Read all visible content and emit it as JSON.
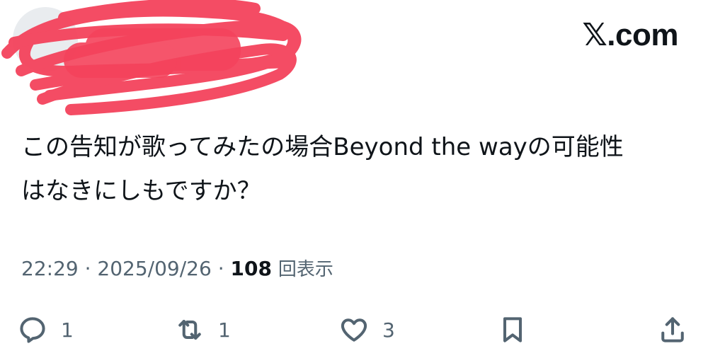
{
  "header": {
    "brand": "𝕏.com"
  },
  "tweet": {
    "text": "この告知が歌ってみたの場合Beyond the wayの可能性\nはなきにしもですか？",
    "time": "22:29",
    "date": "2025/09/26",
    "views": "108",
    "views_label": "回表示"
  },
  "actions": {
    "reply_count": "1",
    "retweet_count": "1",
    "like_count": "3"
  }
}
